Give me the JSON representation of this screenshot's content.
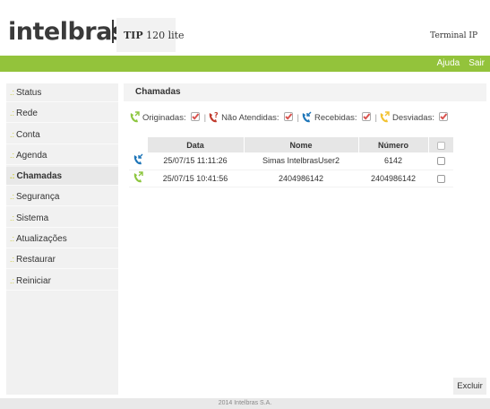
{
  "header": {
    "logo": "intelbras",
    "product_model": "TIP",
    "product_name": "120 lite",
    "device_type": "Terminal IP"
  },
  "topnav": {
    "help": "Ajuda",
    "logout": "Sair"
  },
  "sidebar": {
    "items": [
      {
        "label": "Status"
      },
      {
        "label": "Rede"
      },
      {
        "label": "Conta"
      },
      {
        "label": "Agenda"
      },
      {
        "label": "Chamadas"
      },
      {
        "label": "Segurança"
      },
      {
        "label": "Sistema"
      },
      {
        "label": "Atualizações"
      },
      {
        "label": "Restaurar"
      },
      {
        "label": "Reiniciar"
      }
    ],
    "active": "Chamadas",
    "bullet": ".:"
  },
  "main": {
    "title": "Chamadas",
    "filters": {
      "originated": "Originadas:",
      "missed": "Não Atendidas:",
      "received": "Recebidas:",
      "forwarded": "Desviadas:"
    },
    "table": {
      "columns": [
        "Data",
        "Nome",
        "Número"
      ],
      "rows": [
        {
          "type": "received",
          "date": "25/07/15 11:11:26",
          "name": "Simas IntelbrasUser2",
          "number": "6142"
        },
        {
          "type": "originated",
          "date": "25/07/15 10:41:56",
          "name": "2404986142",
          "number": "2404986142"
        }
      ]
    },
    "delete_button": "Excluir"
  },
  "footer": {
    "copyright": "2014 Intelbras S.A."
  },
  "colors": {
    "brand_green": "#93c33b",
    "originated_icon": "#8dc63f",
    "missed_icon": "#c0392b",
    "received_icon": "#1d75b8",
    "forwarded_icon": "#f2c230",
    "checked_box": "#d9534f"
  }
}
